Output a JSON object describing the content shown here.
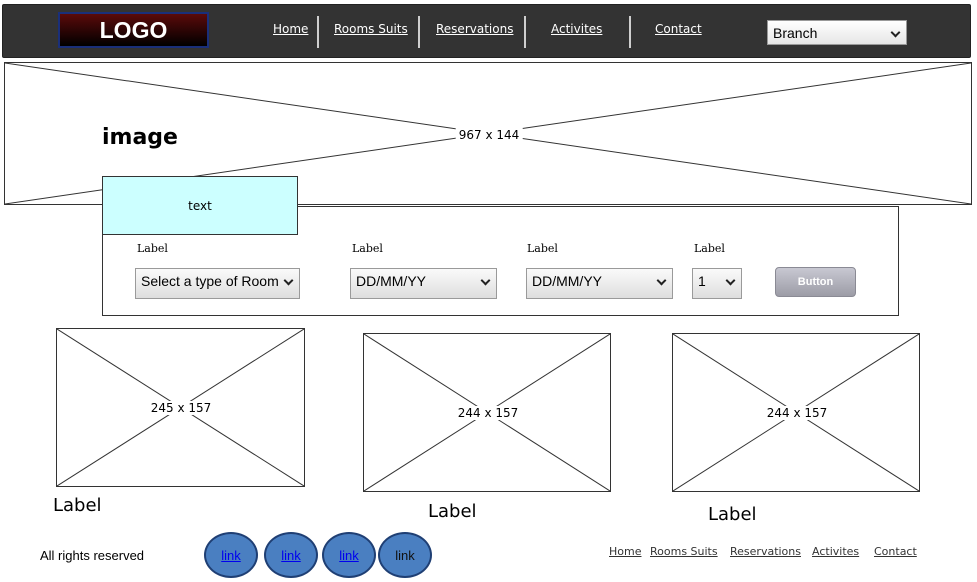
{
  "header": {
    "logo": "LOGO",
    "nav": [
      "Home",
      "Rooms Suits",
      "Reservations",
      "Activites",
      "Contact"
    ],
    "branch_select": "Branch"
  },
  "hero": {
    "word": "image",
    "size_text": "967 x 144"
  },
  "booking": {
    "text_box": "text",
    "fields": [
      {
        "label": "Label",
        "value": "Select a type of Room"
      },
      {
        "label": "Label",
        "value": "DD/MM/YY"
      },
      {
        "label": "Label",
        "value": "DD/MM/YY"
      },
      {
        "label": "Label",
        "value": "1"
      }
    ],
    "button": "Button"
  },
  "thumbnails": [
    {
      "size_text": "245 x 157",
      "label": "Label"
    },
    {
      "size_text": "244 x 157",
      "label": "Label"
    },
    {
      "size_text": "244 x 157",
      "label": "Label"
    }
  ],
  "footer": {
    "rights": "All rights reserved",
    "circles": [
      "link",
      "link",
      "link",
      "link"
    ],
    "nav": [
      "Home",
      "Rooms Suits",
      "Reservations",
      "Activites",
      "Contact"
    ]
  }
}
